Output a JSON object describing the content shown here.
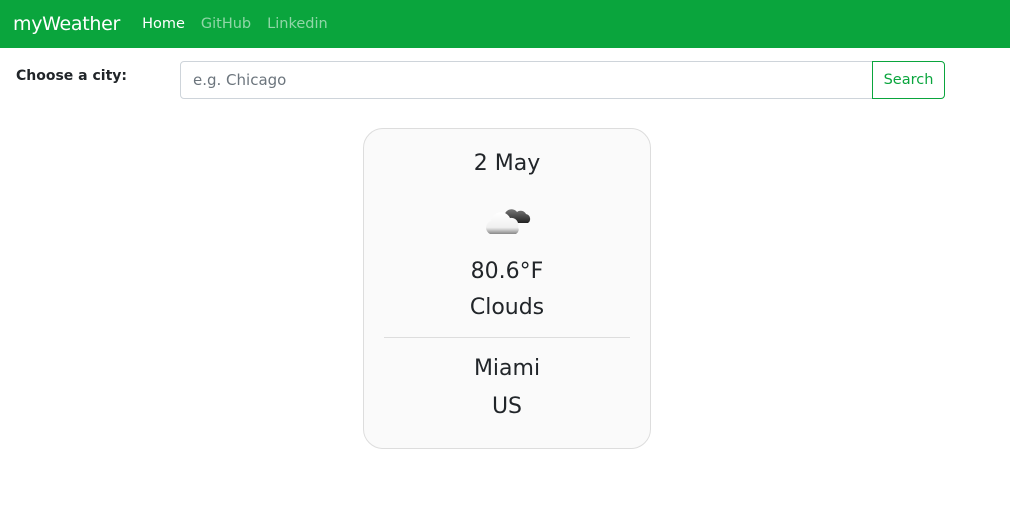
{
  "nav": {
    "brand": "myWeather",
    "links": [
      "Home",
      "GitHub",
      "Linkedin"
    ]
  },
  "search": {
    "label": "Choose a city:",
    "placeholder": "e.g. Chicago",
    "value": "",
    "button": "Search"
  },
  "weather": {
    "date": "2 May",
    "icon": "cloud-icon",
    "temperature": "80.6°F",
    "condition": "Clouds",
    "city": "Miami",
    "country": "US"
  },
  "colors": {
    "brand": "#0aa53d"
  }
}
